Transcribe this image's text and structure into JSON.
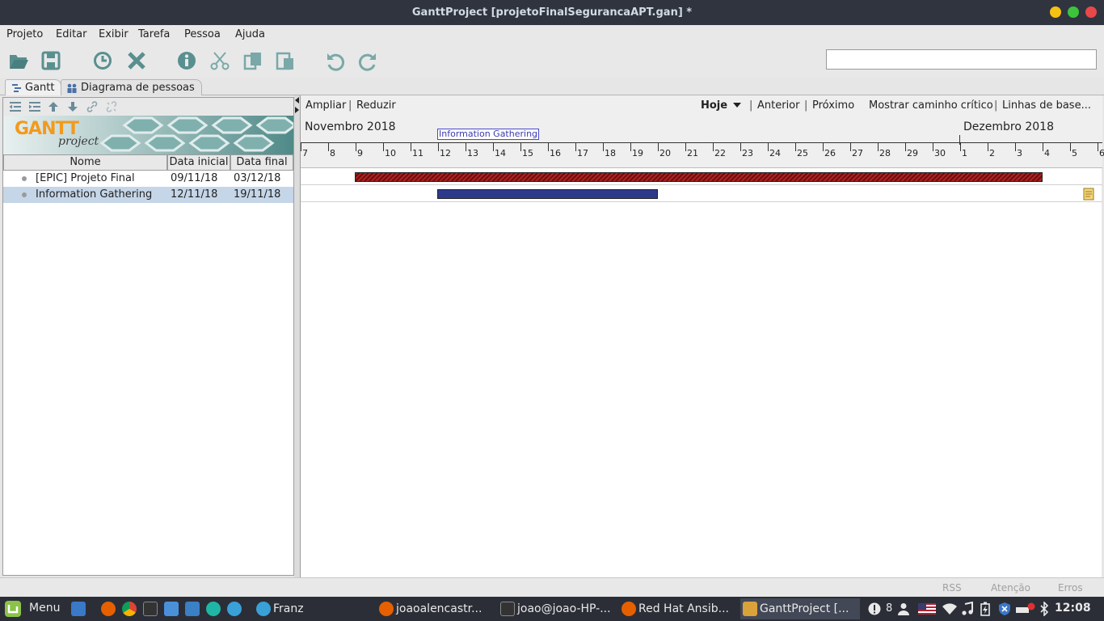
{
  "window": {
    "title": "GanttProject [projetoFinalSegurancaAPT.gan] *"
  },
  "menu": [
    "Projeto",
    "Editar",
    "Exibir",
    "Tarefa",
    "Pessoa",
    "Ajuda"
  ],
  "toolbar": {
    "icons": [
      "open-folder-icon",
      "save-icon",
      "clock-icon",
      "delete-icon",
      "info-icon",
      "cut-icon",
      "copy-icon",
      "paste-icon",
      "undo-icon",
      "redo-icon"
    ],
    "search_value": ""
  },
  "tabs": [
    "Gantt",
    "Diagrama de pessoas"
  ],
  "left": {
    "logo_text": "GANTT",
    "logo_sub": "project",
    "columns": [
      "Nome",
      "Data inicial",
      "Data final"
    ],
    "tasks": [
      {
        "name": "[EPIC] Projeto Final",
        "start": "09/11/18",
        "end": "03/12/18"
      },
      {
        "name": "Information Gathering",
        "start": "12/11/18",
        "end": "19/11/18"
      }
    ]
  },
  "chart_nav": {
    "zoom_in": "Ampliar",
    "zoom_out": "Reduzir",
    "today": "Hoje",
    "previous": "Anterior",
    "next": "Próximo",
    "critical_path": "Mostrar caminho crítico",
    "baselines": "Linhas de base..."
  },
  "timeline": {
    "months": [
      "Novembro 2018",
      "Dezembro 2018"
    ],
    "days": [
      "7",
      "8",
      "9",
      "10",
      "11",
      "12",
      "13",
      "14",
      "15",
      "16",
      "17",
      "18",
      "19",
      "20",
      "21",
      "22",
      "23",
      "24",
      "25",
      "26",
      "27",
      "28",
      "29",
      "30",
      "1",
      "2",
      "3",
      "4",
      "5",
      "6"
    ],
    "tooltip": "Information Gathering"
  },
  "status": {
    "rss": "RSS",
    "attention": "Atenção",
    "errors": "Erros"
  },
  "taskbar": {
    "menu": "Menu",
    "windows": [
      "Franz",
      "joaoalencastr...",
      "joao@joao-HP-...",
      "Red Hat Ansib...",
      "GanttProject [..."
    ],
    "notif_count": "8",
    "clock": "12:08"
  },
  "colors": {
    "epic_bar": "#b22222",
    "task_bar": "#2d3a8c",
    "titlebar": "#2f343f",
    "taskbar": "#2b2e37"
  }
}
